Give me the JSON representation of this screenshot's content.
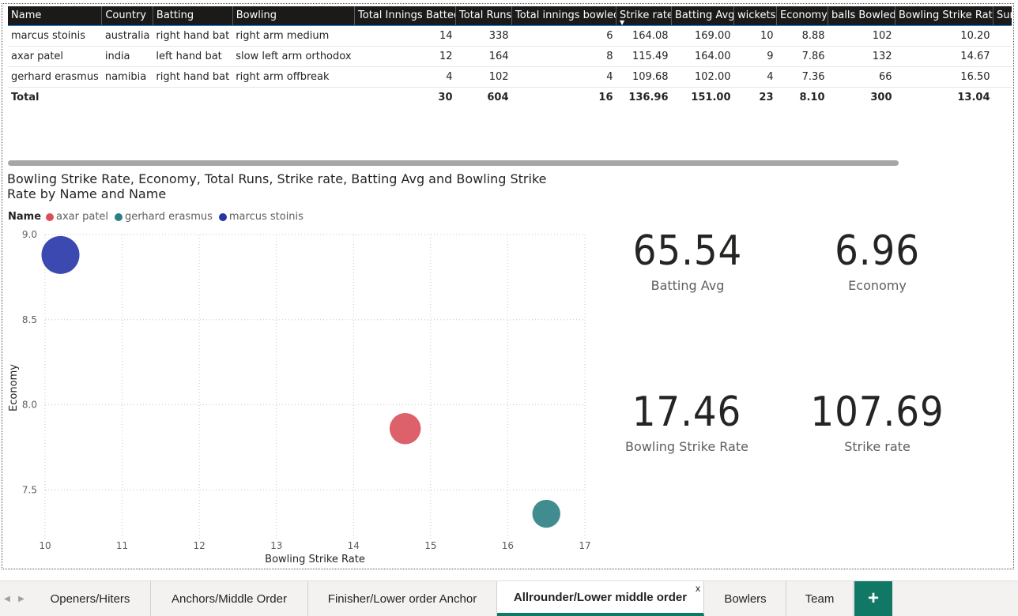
{
  "table": {
    "headers": [
      "Name",
      "Country",
      "Batting",
      "Bowling",
      "Total Innings Batted",
      "Total Runs",
      "Total innings bowled",
      "Strike rate",
      "Batting Avg",
      "wickets",
      "Economy",
      "balls Bowled",
      "Bowling Strike Rate",
      "Sum of b"
    ],
    "rows": [
      [
        "marcus stoinis",
        "australia",
        "right hand bat",
        "right arm medium",
        "14",
        "338",
        "6",
        "164.08",
        "169.00",
        "10",
        "8.88",
        "102",
        "10.20",
        ""
      ],
      [
        "axar patel",
        "india",
        "left hand bat",
        "slow left arm orthodox",
        "12",
        "164",
        "8",
        "115.49",
        "164.00",
        "9",
        "7.86",
        "132",
        "14.67",
        ""
      ],
      [
        "gerhard erasmus",
        "namibia",
        "right hand bat",
        "right arm offbreak",
        "4",
        "102",
        "4",
        "109.68",
        "102.00",
        "4",
        "7.36",
        "66",
        "16.50",
        ""
      ]
    ],
    "total": [
      "Total",
      "",
      "",
      "",
      "30",
      "604",
      "16",
      "136.96",
      "151.00",
      "23",
      "8.10",
      "300",
      "13.04",
      ""
    ],
    "sorted_column": "Strike rate"
  },
  "chart": {
    "title": "Bowling Strike Rate, Economy, Total Runs, Strike rate, Batting Avg and Bowling Strike Rate by Name and Name",
    "legend_label": "Name",
    "legend": [
      {
        "name": "axar patel",
        "color": "#d9505b"
      },
      {
        "name": "gerhard erasmus",
        "color": "#2b8083"
      },
      {
        "name": "marcus stoinis",
        "color": "#2635a7"
      }
    ]
  },
  "chart_data": {
    "type": "scatter",
    "title": "Bowling Strike Rate, Economy, Total Runs, Strike rate, Batting Avg and Bowling Strike Rate by Name and Name",
    "xlabel": "Bowling Strike Rate",
    "ylabel": "Economy",
    "xlim": [
      10,
      17
    ],
    "ylim": [
      7.2,
      9.0
    ],
    "xticks": [
      "10",
      "11",
      "12",
      "13",
      "14",
      "15",
      "16",
      "17"
    ],
    "yticks": [
      "9.0",
      "8.5",
      "8.0",
      "7.5"
    ],
    "grid": true,
    "legend_position": "top-left",
    "series": [
      {
        "name": "axar patel",
        "color": "#d9505b",
        "x": 14.67,
        "y": 7.86,
        "size": 164
      },
      {
        "name": "gerhard erasmus",
        "color": "#2b8083",
        "x": 16.5,
        "y": 7.36,
        "size": 102
      },
      {
        "name": "marcus stoinis",
        "color": "#2635a7",
        "x": 10.2,
        "y": 8.88,
        "size": 338
      }
    ]
  },
  "cards": [
    {
      "value": "65.54",
      "label": "Batting Avg"
    },
    {
      "value": "6.96",
      "label": "Economy"
    },
    {
      "value": "17.46",
      "label": "Bowling Strike Rate"
    },
    {
      "value": "107.69",
      "label": "Strike rate"
    }
  ],
  "tabs": [
    {
      "label": "Openers/Hiters"
    },
    {
      "label": "Anchors/Middle Order"
    },
    {
      "label": "Finisher/Lower order Anchor"
    },
    {
      "label": "Allrounder/Lower middle order",
      "active": true,
      "close": "x"
    },
    {
      "label": "Bowlers"
    },
    {
      "label": "Team"
    }
  ],
  "add_tab_label": "+"
}
